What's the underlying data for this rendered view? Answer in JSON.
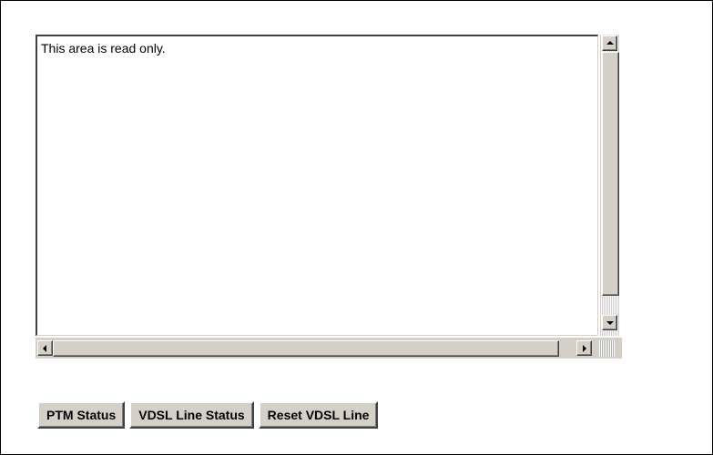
{
  "textarea": {
    "content": "This area is read only."
  },
  "buttons": {
    "ptm_status": "PTM Status",
    "vdsl_line_status": "VDSL Line Status",
    "reset_vdsl_line": "Reset VDSL Line"
  },
  "icons": {
    "scroll_up": "scroll-up-arrow-icon",
    "scroll_down": "scroll-down-arrow-icon",
    "scroll_left": "scroll-left-arrow-icon",
    "scroll_right": "scroll-right-arrow-icon"
  },
  "colors": {
    "button_face": "#d4d0c8",
    "border": "#000000"
  }
}
